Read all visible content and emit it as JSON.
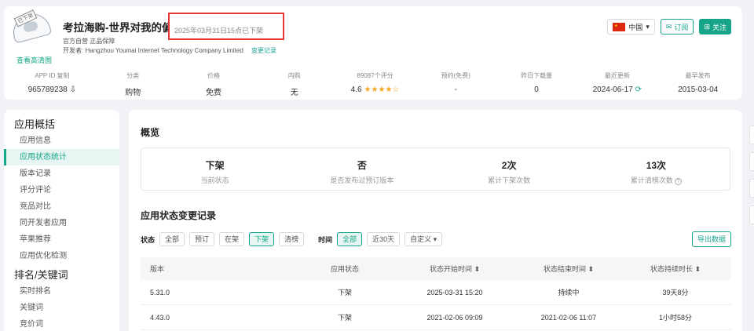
{
  "app": {
    "title": "考拉海购-世界对我的偏爱",
    "delisted_notice": "2025年03月31日15点已下架",
    "stamp_label": "已下架",
    "hd_link": "查看高清图",
    "official": "官方自营 正品保障",
    "developer_label": "开发者:",
    "developer": "Hangzhou Youmai Internet Technology Company Limited",
    "change_record": "变更记录"
  },
  "header_buttons": {
    "country": "中国",
    "subscribe": "订阅",
    "follow": "关注"
  },
  "stats": [
    {
      "label": "APP ID 复制",
      "value": "965789238"
    },
    {
      "label": "分类",
      "value": "购物"
    },
    {
      "label": "价格",
      "value": "免费"
    },
    {
      "label": "内购",
      "value": "无"
    },
    {
      "label": "89087个评分",
      "value": "4.6",
      "stars": "★★★★☆"
    },
    {
      "label": "预约(免费)",
      "value": "-"
    },
    {
      "label": "昨日下载量",
      "value": "0"
    },
    {
      "label": "最近更新",
      "value": "2024-06-17"
    },
    {
      "label": "最早发布",
      "value": "2015-03-04"
    }
  ],
  "sidebar": {
    "group1": "应用概括",
    "items1": [
      "应用信息",
      "应用状态统计",
      "版本记录",
      "评分评论",
      "竞品对比",
      "同开发者应用",
      "苹果推荐",
      "应用优化检测"
    ],
    "group2": "排名/关键词",
    "items2": [
      "实时排名",
      "关键词",
      "竞价词"
    ]
  },
  "main": {
    "overview_title": "概览",
    "overview": [
      {
        "value": "下架",
        "label": "当前状态"
      },
      {
        "value": "否",
        "label": "是否发布过预订版本"
      },
      {
        "value": "2次",
        "label": "累计下架次数"
      },
      {
        "value": "13次",
        "label": "累计清榜次数"
      }
    ],
    "records_title": "应用状态变更记录",
    "filter_status_label": "状态",
    "status_options": [
      "全部",
      "预订",
      "在架",
      "下架",
      "清榜"
    ],
    "filter_time_label": "时间",
    "time_options": [
      "全部",
      "近30天"
    ],
    "custom": "自定义 ▾",
    "export": "导出数据"
  },
  "table": {
    "headers": [
      "版本",
      "应用状态",
      "状态开始时间 ⬍",
      "状态结束时间 ⬍",
      "状态持续时长 ⬍"
    ],
    "rows": [
      [
        "5.31.0",
        "下架",
        "2025-03-31 15:20",
        "持续中",
        "39天8分"
      ],
      [
        "4.43.0",
        "下架",
        "2021-02-06 09:09",
        "2021-02-06 11:07",
        "1小时58分"
      ]
    ]
  }
}
